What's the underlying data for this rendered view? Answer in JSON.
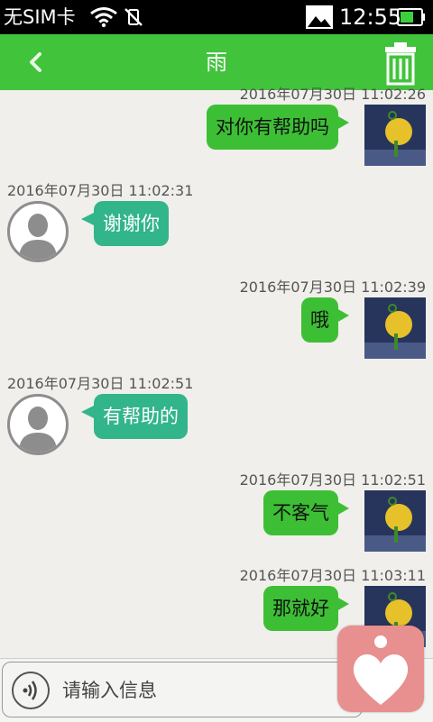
{
  "status_bar": {
    "carrier": "无SIM卡",
    "time": "12:55"
  },
  "header": {
    "title": "雨",
    "back_icon": "chevron-left-icon",
    "trash_icon": "trash-icon"
  },
  "messages": [
    {
      "direction": "outgoing",
      "timestamp": "2016年07月30日 11:02:26",
      "text": "对你有帮助吗"
    },
    {
      "direction": "incoming",
      "timestamp": "2016年07月30日 11:02:31",
      "text": "谢谢你"
    },
    {
      "direction": "outgoing",
      "timestamp": "2016年07月30日 11:02:39",
      "text": "哦"
    },
    {
      "direction": "incoming",
      "timestamp": "2016年07月30日 11:02:51",
      "text": "有帮助的"
    },
    {
      "direction": "outgoing",
      "timestamp": "2016年07月30日 11:02:51",
      "text": "不客气"
    },
    {
      "direction": "outgoing",
      "timestamp": "2016年07月30日 11:03:11",
      "text": "那就好"
    }
  ],
  "input_bar": {
    "placeholder": "请输入信息",
    "voice_icon": "voice-wave-icon"
  },
  "floating_button": {
    "icon": "heart-person-icon"
  },
  "colors": {
    "header_green": "#42c33c",
    "outgoing_bubble": "#3dbf35",
    "incoming_bubble": "#32b58a",
    "background": "#f0efeb",
    "floating_button": "#e88f8f"
  }
}
